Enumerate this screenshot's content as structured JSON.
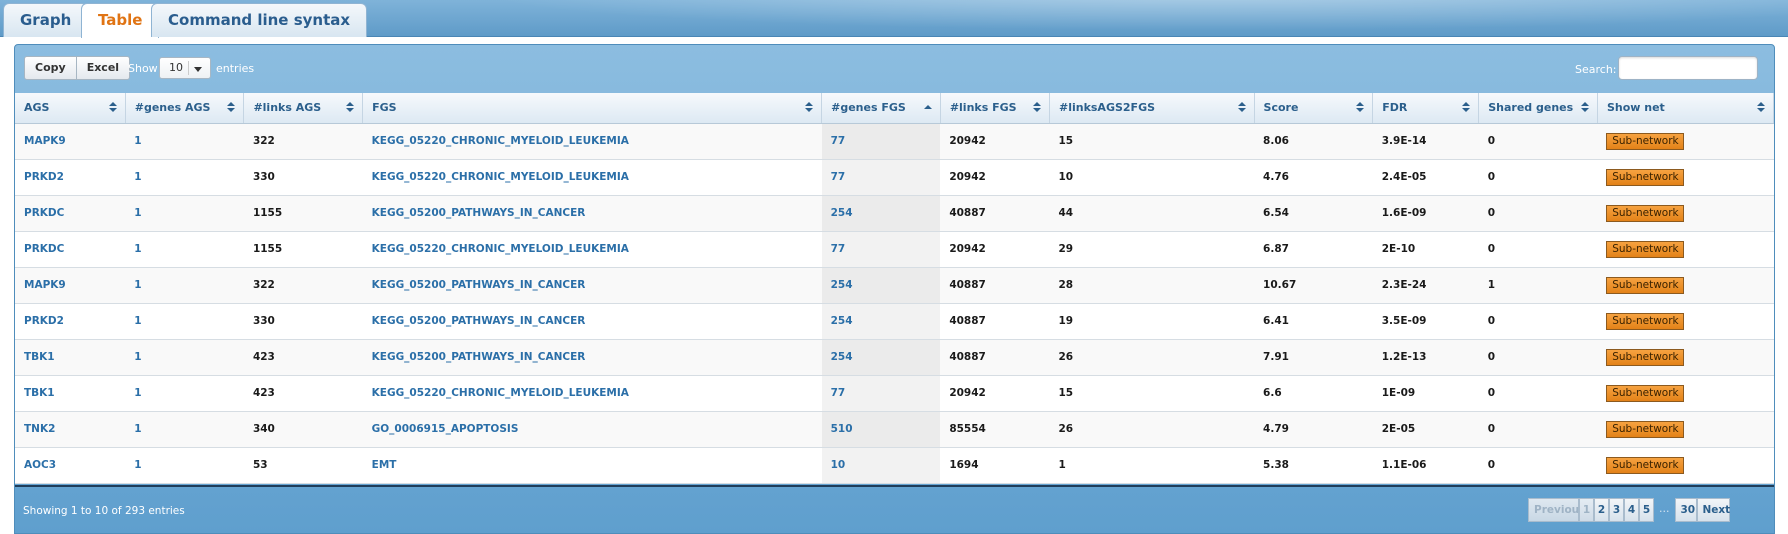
{
  "tabs": [
    {
      "label": "Graph",
      "active": false
    },
    {
      "label": "Table",
      "active": true
    },
    {
      "label": "Command line syntax",
      "active": false
    }
  ],
  "toolbar": {
    "copy_label": "Copy",
    "excel_label": "Excel",
    "show_label": "Show",
    "entries_value": "10",
    "entries_label": "entries",
    "search_label": "Search:",
    "search_value": ""
  },
  "columns": [
    "AGS",
    "#genes AGS",
    "#links AGS",
    "FGS",
    "#genes FGS",
    "#links FGS",
    "#linksAGS2FGS",
    "Score",
    "FDR",
    "Shared genes",
    "Show net"
  ],
  "sorted_column": "#genes FGS",
  "rows": [
    {
      "ags": "MAPK9",
      "genes_ags": "1",
      "links_ags": "322",
      "fgs": "KEGG_05220_CHRONIC_MYELOID_LEUKEMIA",
      "genes_fgs": "77",
      "links_fgs": "20942",
      "links_ags2fgs": "15",
      "score": "8.06",
      "fdr": "3.9E-14",
      "shared": "0",
      "action": "Sub-network"
    },
    {
      "ags": "PRKD2",
      "genes_ags": "1",
      "links_ags": "330",
      "fgs": "KEGG_05220_CHRONIC_MYELOID_LEUKEMIA",
      "genes_fgs": "77",
      "links_fgs": "20942",
      "links_ags2fgs": "10",
      "score": "4.76",
      "fdr": "2.4E-05",
      "shared": "0",
      "action": "Sub-network"
    },
    {
      "ags": "PRKDC",
      "genes_ags": "1",
      "links_ags": "1155",
      "fgs": "KEGG_05200_PATHWAYS_IN_CANCER",
      "genes_fgs": "254",
      "links_fgs": "40887",
      "links_ags2fgs": "44",
      "score": "6.54",
      "fdr": "1.6E-09",
      "shared": "0",
      "action": "Sub-network"
    },
    {
      "ags": "PRKDC",
      "genes_ags": "1",
      "links_ags": "1155",
      "fgs": "KEGG_05220_CHRONIC_MYELOID_LEUKEMIA",
      "genes_fgs": "77",
      "links_fgs": "20942",
      "links_ags2fgs": "29",
      "score": "6.87",
      "fdr": "2E-10",
      "shared": "0",
      "action": "Sub-network"
    },
    {
      "ags": "MAPK9",
      "genes_ags": "1",
      "links_ags": "322",
      "fgs": "KEGG_05200_PATHWAYS_IN_CANCER",
      "genes_fgs": "254",
      "links_fgs": "40887",
      "links_ags2fgs": "28",
      "score": "10.67",
      "fdr": "2.3E-24",
      "shared": "1",
      "action": "Sub-network"
    },
    {
      "ags": "PRKD2",
      "genes_ags": "1",
      "links_ags": "330",
      "fgs": "KEGG_05200_PATHWAYS_IN_CANCER",
      "genes_fgs": "254",
      "links_fgs": "40887",
      "links_ags2fgs": "19",
      "score": "6.41",
      "fdr": "3.5E-09",
      "shared": "0",
      "action": "Sub-network"
    },
    {
      "ags": "TBK1",
      "genes_ags": "1",
      "links_ags": "423",
      "fgs": "KEGG_05200_PATHWAYS_IN_CANCER",
      "genes_fgs": "254",
      "links_fgs": "40887",
      "links_ags2fgs": "26",
      "score": "7.91",
      "fdr": "1.2E-13",
      "shared": "0",
      "action": "Sub-network"
    },
    {
      "ags": "TBK1",
      "genes_ags": "1",
      "links_ags": "423",
      "fgs": "KEGG_05220_CHRONIC_MYELOID_LEUKEMIA",
      "genes_fgs": "77",
      "links_fgs": "20942",
      "links_ags2fgs": "15",
      "score": "6.6",
      "fdr": "1E-09",
      "shared": "0",
      "action": "Sub-network"
    },
    {
      "ags": "TNK2",
      "genes_ags": "1",
      "links_ags": "340",
      "fgs": "GO_0006915_APOPTOSIS",
      "genes_fgs": "510",
      "links_fgs": "85554",
      "links_ags2fgs": "26",
      "score": "4.79",
      "fdr": "2E-05",
      "shared": "0",
      "action": "Sub-network"
    },
    {
      "ags": "AOC3",
      "genes_ags": "1",
      "links_ags": "53",
      "fgs": "EMT",
      "genes_fgs": "10",
      "links_fgs": "1694",
      "links_ags2fgs": "1",
      "score": "5.38",
      "fdr": "1.1E-06",
      "shared": "0",
      "action": "Sub-network"
    }
  ],
  "footer": {
    "info": "Showing 1 to 10 of 293 entries",
    "previous_label": "Previous",
    "pages": [
      "1",
      "2",
      "3",
      "4",
      "5"
    ],
    "current_page": "1",
    "ellipsis": "…",
    "last_page": "30",
    "next_label": "Next"
  }
}
